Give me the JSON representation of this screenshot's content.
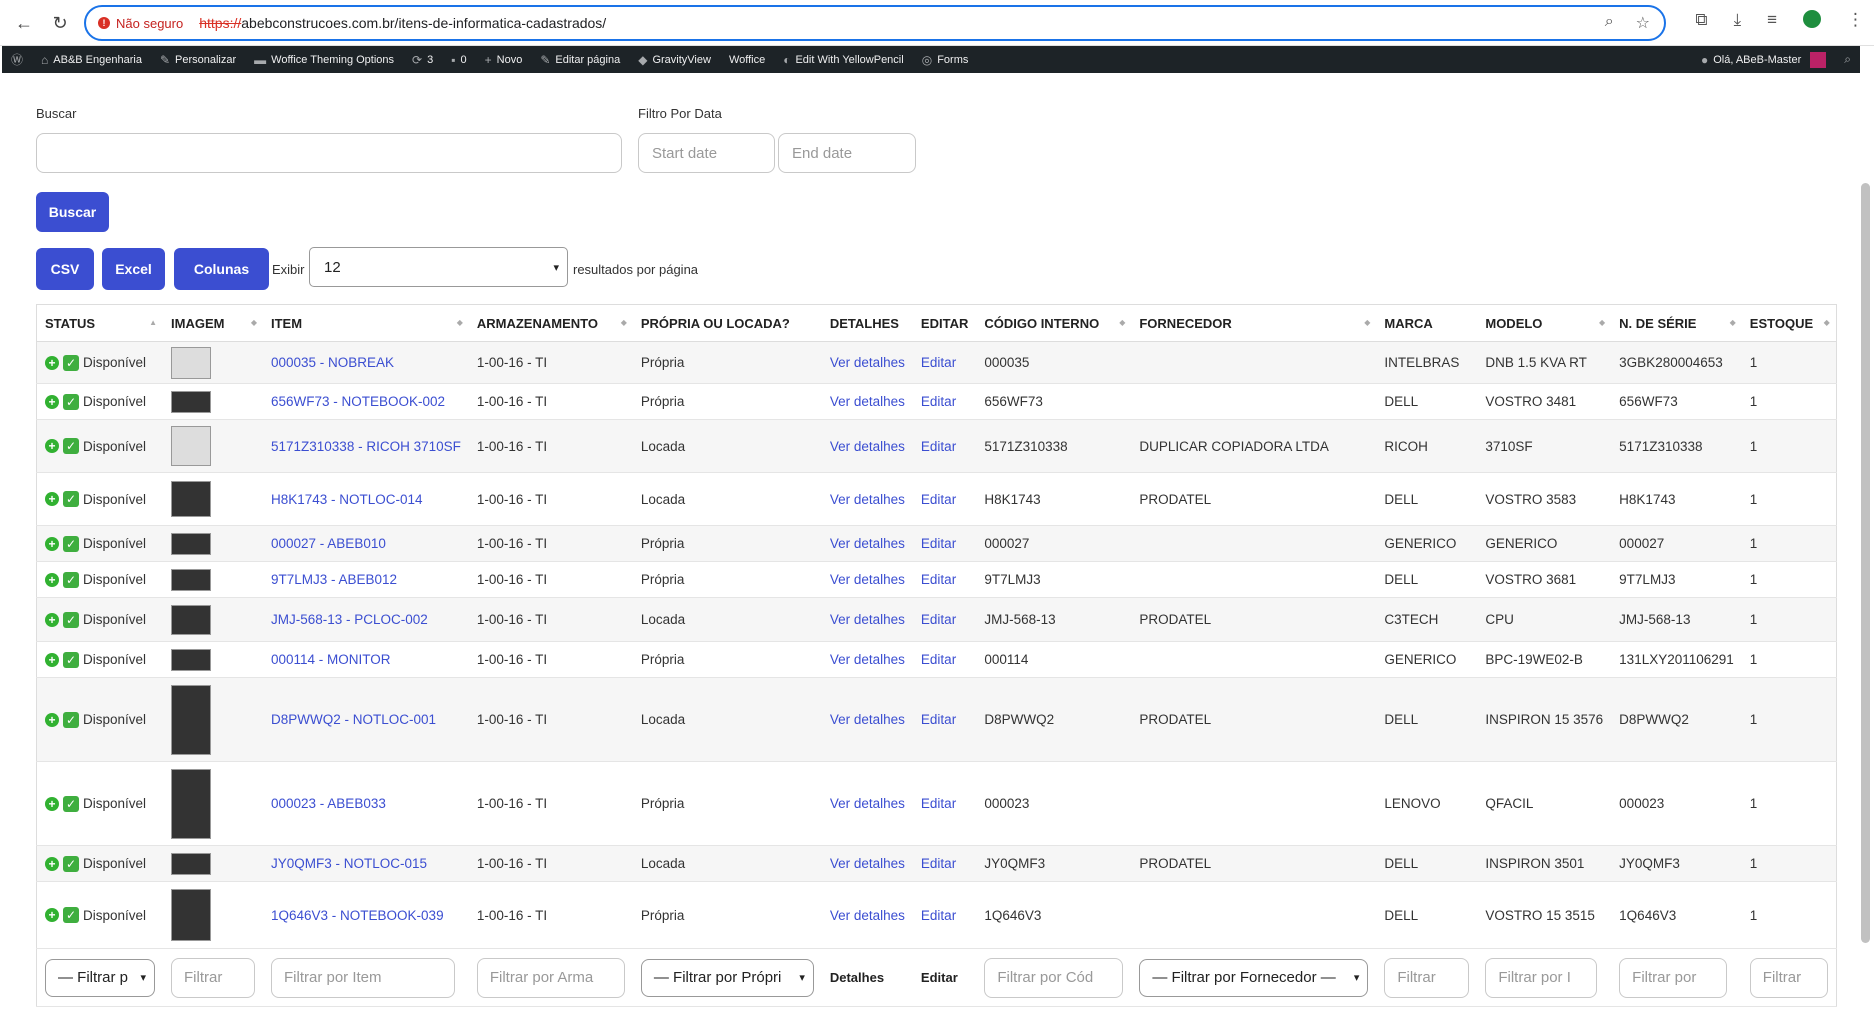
{
  "browser": {
    "insecure_label": "Não seguro",
    "url_scheme": "https://",
    "url_rest": "abebconstrucoes.com.br/itens-de-informatica-cadastrados/"
  },
  "adminbar": {
    "site": "AB&B Engenharia",
    "customize": "Personalizar",
    "theme_options": "Woffice Theming Options",
    "updates": "3",
    "comments": "0",
    "new": "Novo",
    "edit_page": "Editar página",
    "gravityview": "GravityView",
    "woffice": "Woffice",
    "yellowpencil": "Edit With YellowPencil",
    "forms": "Forms",
    "greeting": "Olá, ABeB-Master"
  },
  "search": {
    "label": "Buscar",
    "date_label": "Filtro Por Data",
    "start_placeholder": "Start date",
    "end_placeholder": "End date",
    "button": "Buscar"
  },
  "toolbar": {
    "csv": "CSV",
    "excel": "Excel",
    "columns": "Colunas",
    "show_label": "Exibir",
    "per_page": "12",
    "per_page_suffix": "resultados por página"
  },
  "table": {
    "headers": [
      "STATUS",
      "IMAGEM",
      "ITEM",
      "ARMAZENAMENTO",
      "PRÓPRIA OU LOCADA?",
      "DETALHES",
      "EDITAR",
      "CÓDIGO INTERNO",
      "FORNECEDOR",
      "MARCA",
      "MODELO",
      "N. DE SÉRIE",
      "ESTOQUE"
    ],
    "rows": [
      {
        "status": "Disponível",
        "item": "000035 - NOBREAK",
        "arm": "1-00-16 - TI",
        "prop": "Própria",
        "det": "Ver detalhes",
        "edit": "Editar",
        "cod": "000035",
        "forn": "",
        "marca": "INTELBRAS",
        "modelo": "DNB 1.5 KVA RT",
        "serie": "3GBK280004653",
        "estoque": "1"
      },
      {
        "status": "Disponível",
        "item": "656WF73 - NOTEBOOK-002",
        "arm": "1-00-16 - TI",
        "prop": "Própria",
        "det": "Ver detalhes",
        "edit": "Editar",
        "cod": "656WF73",
        "forn": "",
        "marca": "DELL",
        "modelo": "VOSTRO 3481",
        "serie": "656WF73",
        "estoque": "1"
      },
      {
        "status": "Disponível",
        "item": "5171Z310338 - RICOH 3710SF",
        "arm": "1-00-16 - TI",
        "prop": "Locada",
        "det": "Ver detalhes",
        "edit": "Editar",
        "cod": "5171Z310338",
        "forn": "DUPLICAR COPIADORA LTDA",
        "marca": "RICOH",
        "modelo": "3710SF",
        "serie": "5171Z310338",
        "estoque": "1"
      },
      {
        "status": "Disponível",
        "item": "H8K1743 - NOTLOC-014",
        "arm": "1-00-16 - TI",
        "prop": "Locada",
        "det": "Ver detalhes",
        "edit": "Editar",
        "cod": "H8K1743",
        "forn": "PRODATEL",
        "marca": "DELL",
        "modelo": "VOSTRO 3583",
        "serie": "H8K1743",
        "estoque": "1"
      },
      {
        "status": "Disponível",
        "item": "000027 - ABEB010",
        "arm": "1-00-16 - TI",
        "prop": "Própria",
        "det": "Ver detalhes",
        "edit": "Editar",
        "cod": "000027",
        "forn": "",
        "marca": "GENERICO",
        "modelo": "GENERICO",
        "serie": "000027",
        "estoque": "1"
      },
      {
        "status": "Disponível",
        "item": "9T7LMJ3 - ABEB012",
        "arm": "1-00-16 - TI",
        "prop": "Própria",
        "det": "Ver detalhes",
        "edit": "Editar",
        "cod": "9T7LMJ3",
        "forn": "",
        "marca": "DELL",
        "modelo": "VOSTRO 3681",
        "serie": "9T7LMJ3",
        "estoque": "1"
      },
      {
        "status": "Disponível",
        "item": "JMJ-568-13 - PCLOC-002",
        "arm": "1-00-16 - TI",
        "prop": "Locada",
        "det": "Ver detalhes",
        "edit": "Editar",
        "cod": "JMJ-568-13",
        "forn": "PRODATEL",
        "marca": "C3TECH",
        "modelo": "CPU",
        "serie": "JMJ-568-13",
        "estoque": "1"
      },
      {
        "status": "Disponível",
        "item": "000114 - MONITOR",
        "arm": "1-00-16 - TI",
        "prop": "Própria",
        "det": "Ver detalhes",
        "edit": "Editar",
        "cod": "000114",
        "forn": "",
        "marca": "GENERICO",
        "modelo": "BPC-19WE02-B",
        "serie": "131LXY201106291",
        "estoque": "1"
      },
      {
        "status": "Disponível",
        "item": "D8PWWQ2 - NOTLOC-001",
        "arm": "1-00-16 - TI",
        "prop": "Locada",
        "det": "Ver detalhes",
        "edit": "Editar",
        "cod": "D8PWWQ2",
        "forn": "PRODATEL",
        "marca": "DELL",
        "modelo": "INSPIRON 15 3576",
        "serie": "D8PWWQ2",
        "estoque": "1"
      },
      {
        "status": "Disponível",
        "item": "000023 - ABEB033",
        "arm": "1-00-16 - TI",
        "prop": "Própria",
        "det": "Ver detalhes",
        "edit": "Editar",
        "cod": "000023",
        "forn": "",
        "marca": "LENOVO",
        "modelo": "QFACIL",
        "serie": "000023",
        "estoque": "1"
      },
      {
        "status": "Disponível",
        "item": "JY0QMF3 - NOTLOC-015",
        "arm": "1-00-16 - TI",
        "prop": "Locada",
        "det": "Ver detalhes",
        "edit": "Editar",
        "cod": "JY0QMF3",
        "forn": "PRODATEL",
        "marca": "DELL",
        "modelo": "INSPIRON 3501",
        "serie": "JY0QMF3",
        "estoque": "1"
      },
      {
        "status": "Disponível",
        "item": "1Q646V3 - NOTEBOOK-039",
        "arm": "1-00-16 - TI",
        "prop": "Própria",
        "det": "Ver detalhes",
        "edit": "Editar",
        "cod": "1Q646V3",
        "forn": "",
        "marca": "DELL",
        "modelo": "VOSTRO 15 3515",
        "serie": "1Q646V3",
        "estoque": "1"
      }
    ],
    "filters": {
      "status": "— Filtrar p",
      "image": "Filtrar",
      "item": "Filtrar por Item",
      "arm": "Filtrar por Arma",
      "prop": "— Filtrar por Própri",
      "det": "Detalhes",
      "edit": "Editar",
      "cod": "Filtrar por Cód",
      "forn": "— Filtrar por Fornecedor —",
      "marca": "Filtrar",
      "modelo": "Filtrar por I",
      "serie": "Filtrar por",
      "estoque": "Filtrar"
    }
  }
}
